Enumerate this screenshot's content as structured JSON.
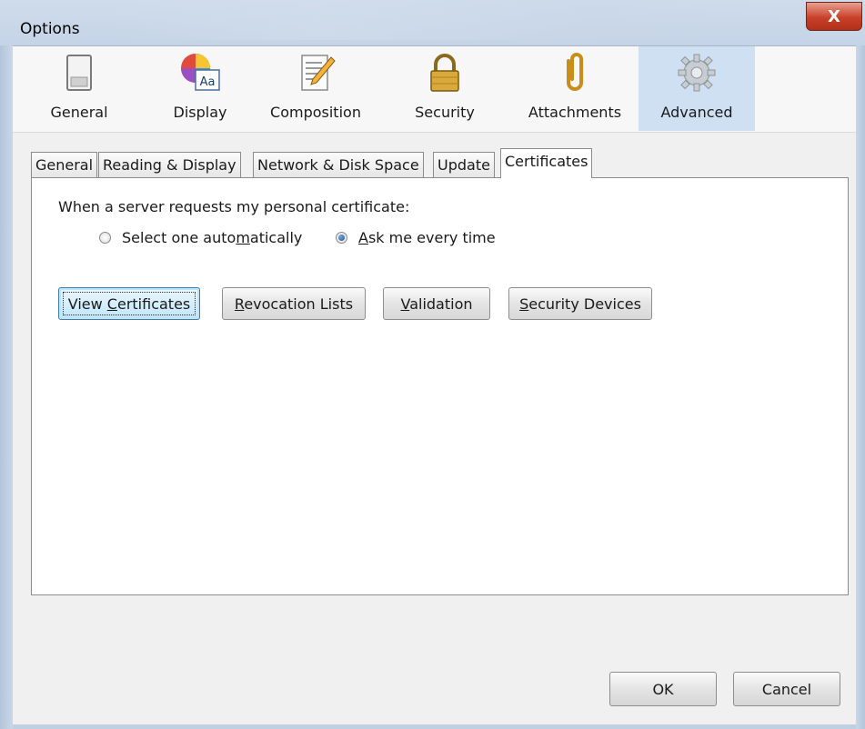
{
  "window": {
    "title": "Options",
    "close_label": "X"
  },
  "toolbar": {
    "items": [
      {
        "label": "General",
        "icon": "switch-icon"
      },
      {
        "label": "Display",
        "icon": "color-font-icon"
      },
      {
        "label": "Composition",
        "icon": "pencil-document-icon"
      },
      {
        "label": "Security",
        "icon": "padlock-icon"
      },
      {
        "label": "Attachments",
        "icon": "paperclip-icon"
      },
      {
        "label": "Advanced",
        "icon": "gear-icon",
        "selected": true
      }
    ]
  },
  "tabs": [
    {
      "label": "General"
    },
    {
      "label": "Reading & Display"
    },
    {
      "label": "Network & Disk Space"
    },
    {
      "label": "Update"
    },
    {
      "label": "Certificates",
      "active": true
    }
  ],
  "certificates": {
    "prompt": "When a server requests my personal certificate:",
    "options": [
      {
        "pre": "Select one auto",
        "ul": "m",
        "post": "atically",
        "checked": false
      },
      {
        "pre": "",
        "ul": "A",
        "post": "sk me every time",
        "checked": true
      }
    ],
    "buttons": [
      {
        "pre": "View ",
        "ul": "C",
        "post": "ertificates",
        "default": true
      },
      {
        "pre": "",
        "ul": "R",
        "post": "evocation Lists"
      },
      {
        "pre": "",
        "ul": "V",
        "post": "alidation"
      },
      {
        "pre": "",
        "ul": "S",
        "post": "ecurity Devices"
      }
    ]
  },
  "footer": {
    "ok_label": "OK",
    "cancel_label": "Cancel"
  },
  "colors": {
    "selected_toolbar": "#cfe0f3",
    "close_button": "#c8402a",
    "default_button_border": "#3c7fb1"
  }
}
